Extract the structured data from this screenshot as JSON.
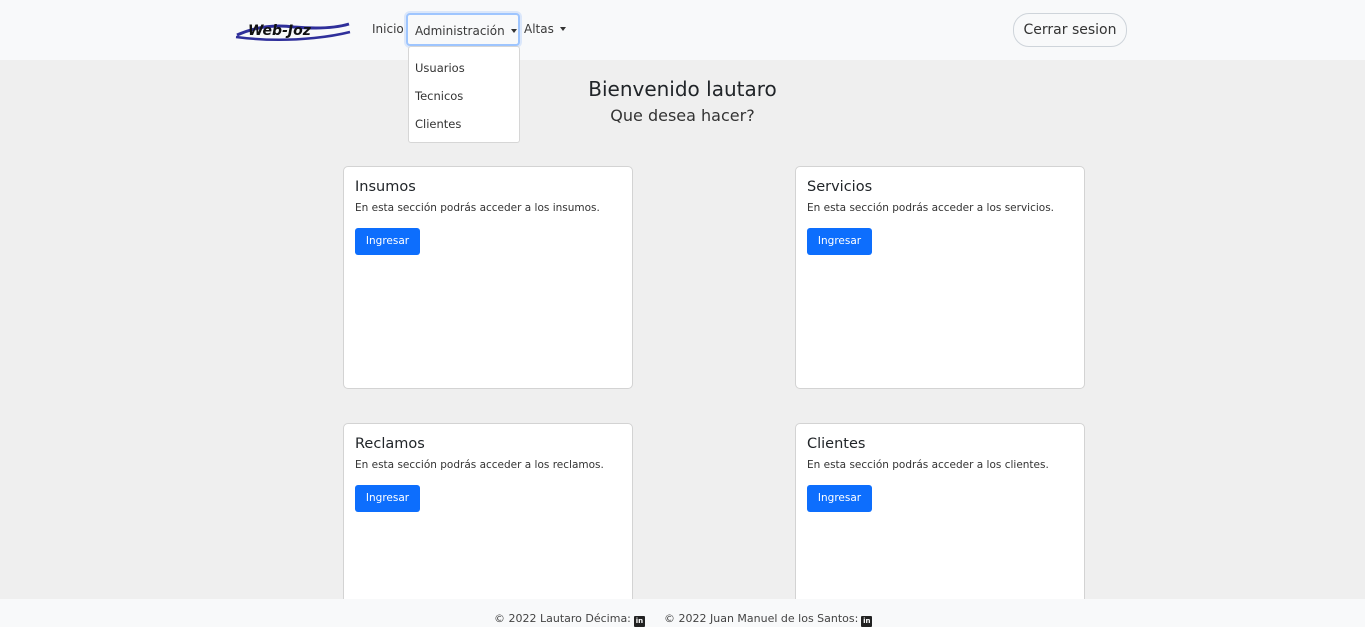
{
  "navbar": {
    "logo_text": "Web-Joz",
    "links": {
      "inicio": "Inicio",
      "administracion": "Administración",
      "altas": "Altas"
    },
    "logout_label": "Cerrar sesion",
    "dropdown_items": [
      "Usuarios",
      "Tecnicos",
      "Clientes"
    ]
  },
  "main": {
    "welcome": "Bienvenido lautaro",
    "subtitle": "Que desea hacer?",
    "cards": [
      {
        "title": "Insumos",
        "text": "En esta sección podrás acceder a los insumos.",
        "button": "Ingresar"
      },
      {
        "title": "Servicios",
        "text": "En esta sección podrás acceder a los servicios.",
        "button": "Ingresar"
      },
      {
        "title": "Reclamos",
        "text": "En esta sección podrás acceder a los reclamos.",
        "button": "Ingresar"
      },
      {
        "title": "Clientes",
        "text": "En esta sección podrás acceder a los clientes.",
        "button": "Ingresar"
      }
    ]
  },
  "footer": {
    "credits": [
      "© 2022 Lautaro Décima:",
      "© 2022 Juan Manuel de los Santos:"
    ],
    "icon": "linkedin-icon"
  },
  "colors": {
    "primary": "#0d6efd",
    "background": "#efefef",
    "navbar": "#f8f9fa",
    "logo_blue": "#2f2f9a"
  }
}
